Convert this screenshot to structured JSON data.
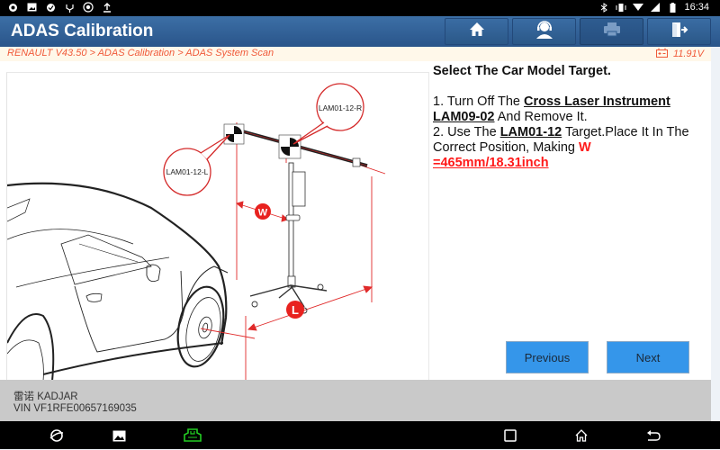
{
  "status_bar": {
    "left_icons": [
      "chat-icon",
      "image-icon",
      "check-circle-icon",
      "usb-icon",
      "settings-circle-icon",
      "upload-icon"
    ],
    "right_icons": [
      "bluetooth-icon",
      "vibrate-icon",
      "wifi-icon",
      "signal-icon",
      "battery-icon"
    ],
    "time": "16:34"
  },
  "header": {
    "title": "ADAS Calibration",
    "buttons": [
      {
        "name": "home",
        "icon": "home-icon"
      },
      {
        "name": "support",
        "icon": "headset-user-icon"
      },
      {
        "name": "print",
        "icon": "printer-icon"
      },
      {
        "name": "exit",
        "icon": "exit-door-icon"
      }
    ]
  },
  "breadcrumb": {
    "path": "RENAULT V43.50 > ADAS Calibration > ADAS System Scan",
    "voltage": "11.91V",
    "voltage_icon": "battery-icon"
  },
  "diagram": {
    "callout_left": "LAM01-12-L",
    "callout_right": "LAM01-12-R",
    "marker_w": "W",
    "marker_l": "L"
  },
  "instructions": {
    "heading": "Select The Car Model Target.",
    "step1_prefix": "1. Turn Off The ",
    "step1_bold": "Cross Laser Instrument LAM09-02",
    "step1_suffix": " And Remove It.",
    "step2_prefix": "2. Use The ",
    "step2_bold": "LAM01-12",
    "step2_mid": " Target.Place It In The Correct Position, Making ",
    "step2_w": "W",
    "step2_value": "=465mm/18.31inch"
  },
  "buttons": {
    "previous": "Previous",
    "next": "Next"
  },
  "vehicle": {
    "model": "雷诺 KADJAR",
    "vin": "VIN VF1RFE00657169035"
  },
  "nav_bar": {
    "left_icons": [
      "browser-planet-icon",
      "gallery-icon",
      "vci-connector-icon"
    ],
    "right_icons": [
      "recent-apps-icon",
      "home-nav-icon",
      "back-icon"
    ]
  },
  "colors": {
    "header_blue": "#2f5e94",
    "breadcrumb_red": "#f05a3a",
    "button_blue": "#3596ea",
    "highlight_red": "#ff1a1a",
    "vci_green": "#22cc22"
  }
}
